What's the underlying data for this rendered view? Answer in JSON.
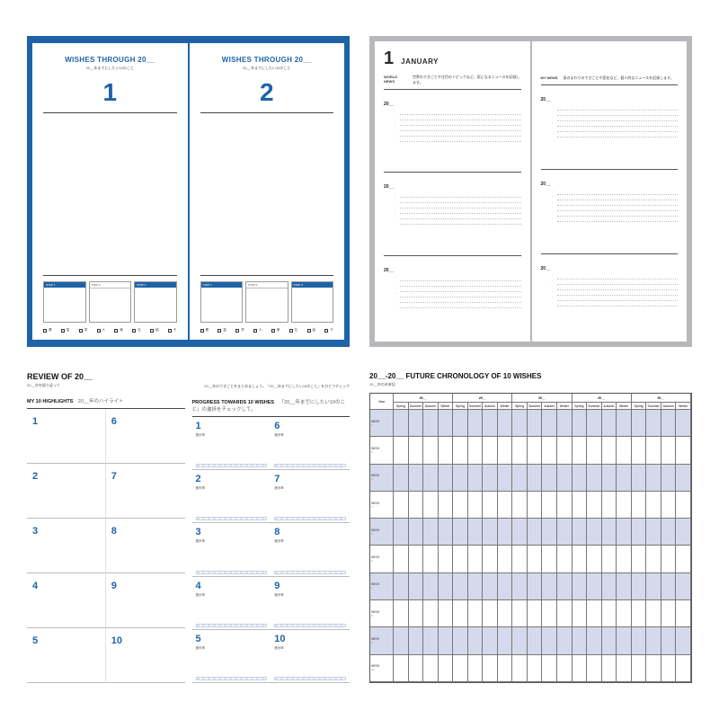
{
  "wishes": {
    "title": "WISHES THROUGH 20__",
    "subtitle": "20__年までにしたい10のこと",
    "pages": [
      {
        "number": "1"
      },
      {
        "number": "2"
      }
    ],
    "step_labels": [
      "STEP 1",
      "STEP 2",
      "STEP 3"
    ],
    "check_labels": [
      "健",
      "富",
      "学",
      "人",
      "家",
      "仕",
      "結",
      "そ"
    ]
  },
  "january": {
    "month_num": "1",
    "month_name": "JANUARY",
    "left_label": "WORLD NEWS",
    "left_desc": "世界のできごとや注目のトピックなど、気になるニュースを記録します。",
    "right_label": "MY NEWS",
    "right_desc": "身のまわりのできごとや変化など、個人的なニュースを記録します。",
    "year_prefix": "20__"
  },
  "review": {
    "heading": "REVIEW OF 20__",
    "sub": "20__年を振り返って",
    "highlights_title": "MY 10 HIGHLIGHTS",
    "highlights_sub": "20__年のハイライト",
    "progress_title": "PROGRESS TOWARDS 10 WISHES",
    "progress_sub": "「20__年までにしたい10のこと」の進捗をチェックして。",
    "progress_sub_pre": "20__年のできごとをまとめましょう。「20__年までにしたい10のこと」をひとつチェック",
    "bar_label": "進歩率",
    "numbers": [
      "1",
      "2",
      "3",
      "4",
      "5",
      "6",
      "7",
      "8",
      "9",
      "10"
    ]
  },
  "chronology": {
    "title": "20__-20__  FUTURE CHRONOLOGY OF 10 WISHES",
    "sub": "10__年の未来記",
    "year_cell": "Year",
    "years": [
      "20__",
      "20__",
      "20__",
      "20__",
      "20__"
    ],
    "seasons": [
      "Spring",
      "Summer",
      "Autumn",
      "Winter"
    ],
    "row_label": "WISH",
    "row_nums": [
      "1",
      "2",
      "3",
      "4",
      "5",
      "6",
      "7",
      "8",
      "9",
      "10"
    ]
  }
}
